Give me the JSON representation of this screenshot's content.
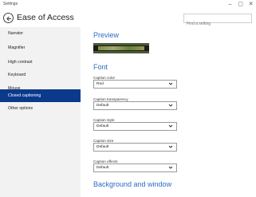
{
  "window": {
    "title": "Settings",
    "minimize": "–",
    "maximize": "▢",
    "close": "✕"
  },
  "header": {
    "title": "Ease of Access",
    "search_placeholder": "Find a setting"
  },
  "sidebar": {
    "items": [
      {
        "label": "Narrator"
      },
      {
        "label": "Magnifier"
      },
      {
        "label": "High contrast"
      },
      {
        "label": "Keyboard"
      },
      {
        "label": "Mouse"
      },
      {
        "label": "Closed captioning",
        "selected": true
      },
      {
        "label": "Other options"
      }
    ]
  },
  "main": {
    "preview_heading": "Preview",
    "font_heading": "Font",
    "background_heading": "Background and window",
    "fields": [
      {
        "label": "Caption color",
        "value": "Red"
      },
      {
        "label": "Caption transparency",
        "value": "Default"
      },
      {
        "label": "Caption style",
        "value": "Default"
      },
      {
        "label": "Caption size",
        "value": "Default"
      },
      {
        "label": "Caption effects",
        "value": "Default"
      }
    ]
  },
  "colors": {
    "accent": "#2a6cc4",
    "selection": "#0b3a8c",
    "sidebar_bg": "#f2f2f2"
  }
}
